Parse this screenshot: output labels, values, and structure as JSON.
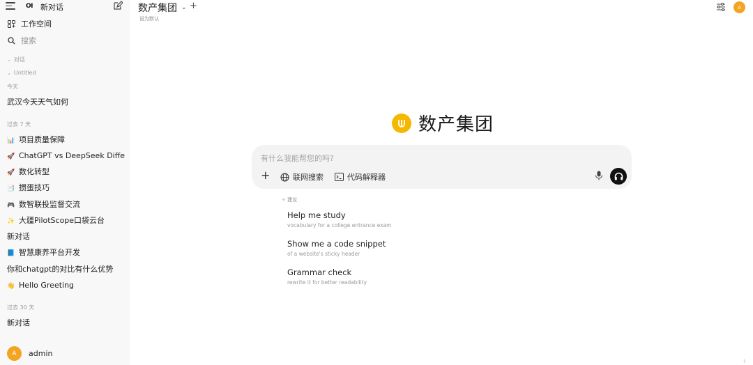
{
  "sidebar": {
    "logo": "OI",
    "new_chat": "新对话",
    "workspace": "工作空间",
    "search_placeholder": "搜索",
    "folders": [
      "对话",
      "Untitled"
    ],
    "groups": [
      {
        "label": "今天",
        "items": [
          {
            "emoji": "",
            "title": "武汉今天天气如何"
          }
        ]
      },
      {
        "label": "过去 7 天",
        "items": [
          {
            "emoji": "📊",
            "title": "项目质量保障"
          },
          {
            "emoji": "🚀",
            "title": "ChatGPT vs DeepSeek Differe"
          },
          {
            "emoji": "🚀",
            "title": "数化转型"
          },
          {
            "emoji": "📑",
            "title": "掼蛋技巧"
          },
          {
            "emoji": "🎮",
            "title": "数智联投监督交流"
          },
          {
            "emoji": "✨",
            "title": "大疆PilotScope口袋云台"
          },
          {
            "emoji": "",
            "title": "新对话"
          },
          {
            "emoji": "📘",
            "title": "智慧康养平台开发"
          },
          {
            "emoji": "",
            "title": "你和chatgpt的对比有什么优势"
          },
          {
            "emoji": "👋",
            "title": "Hello Greeting"
          }
        ]
      },
      {
        "label": "过去 30 天",
        "items": [
          {
            "emoji": "",
            "title": "新对话"
          }
        ]
      }
    ],
    "user": {
      "initial": "A",
      "name": "admin"
    }
  },
  "header": {
    "model_name": "数产集团",
    "caret": "⌄",
    "add": "+",
    "set_default": "设为默认",
    "avatar_initial": "A"
  },
  "main": {
    "brand_name": "数产集团",
    "composer": {
      "placeholder": "有什么我能帮您的吗?",
      "plus": "+",
      "web_search": "联网搜索",
      "code_interpreter": "代码解释器"
    },
    "suggestions_label": "建议",
    "suggestions": [
      {
        "title": "Help me study",
        "subtitle": "vocabulary for a college entrance exam"
      },
      {
        "title": "Show me a code snippet",
        "subtitle": "of a website's sticky header"
      },
      {
        "title": "Grammar check",
        "subtitle": "rewrite it for better readability"
      }
    ],
    "help": "?"
  },
  "colors": {
    "accent": "#f4a422",
    "brand_logo": "#f5b800",
    "sidebar_bg": "#f8f8f8",
    "composer_bg": "#f3f3f3"
  }
}
